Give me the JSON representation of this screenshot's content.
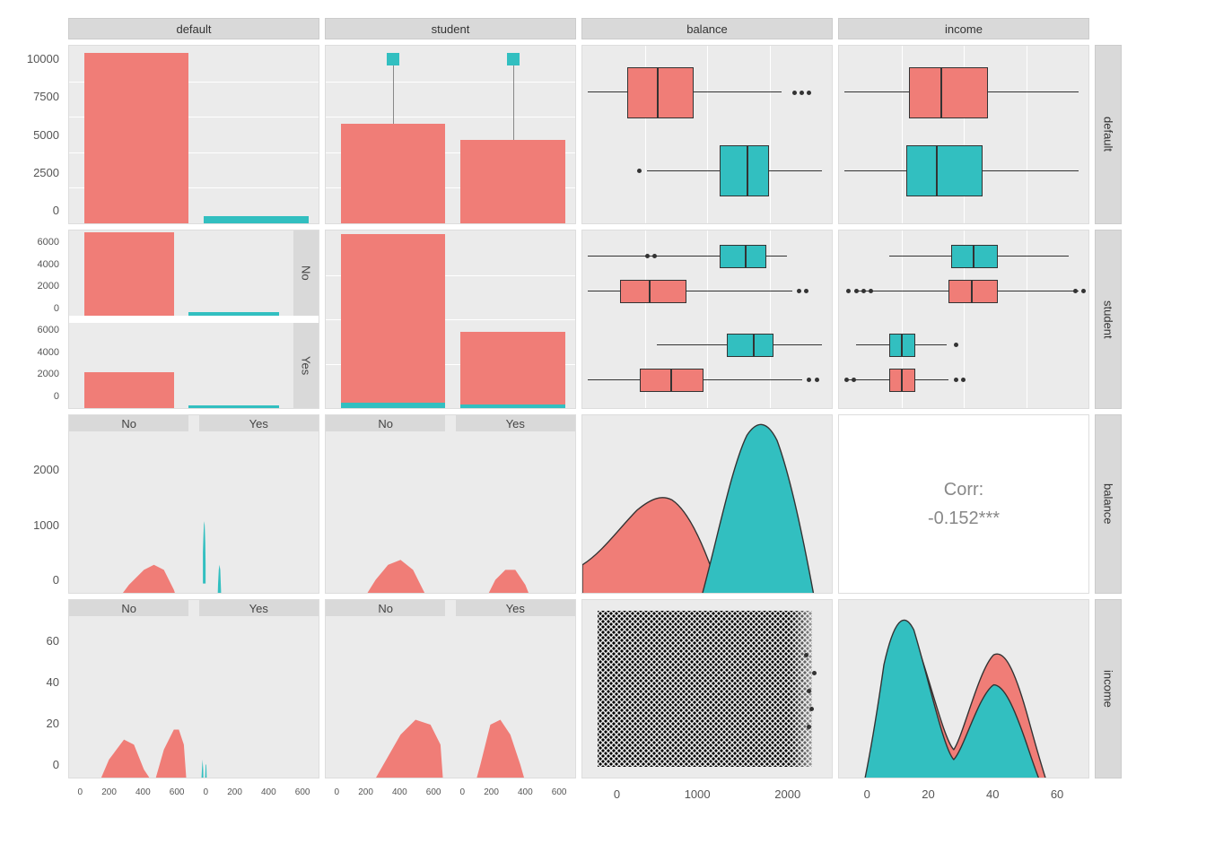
{
  "variables": [
    "default",
    "student",
    "balance",
    "income"
  ],
  "colors": {
    "No": "#f07d77",
    "Yes": "#32bfc0"
  },
  "correlation": {
    "label": "Corr:",
    "value": "-0.152***"
  },
  "facet_levels": {
    "default": [
      "No",
      "Yes"
    ],
    "student": [
      "No",
      "Yes"
    ]
  },
  "y_axes": {
    "row1": [
      "10000",
      "7500",
      "5000",
      "2500",
      "0"
    ],
    "row2": [
      "6000",
      "4000",
      "2000",
      "0",
      "6000",
      "4000",
      "2000",
      "0"
    ],
    "row3": [
      "2000",
      "1000",
      "0"
    ],
    "row4": [
      "60",
      "40",
      "20",
      "0"
    ]
  },
  "x_axes": {
    "col12_bottom": [
      "0",
      "200",
      "400",
      "600",
      "0",
      "200",
      "400",
      "600"
    ],
    "col3_bottom": [
      "0",
      "1000",
      "2000"
    ],
    "col4_bottom": [
      "0",
      "20",
      "40",
      "60"
    ]
  },
  "chart_data": [
    {
      "row": "default",
      "col": "default",
      "type": "bar",
      "x": [
        "No",
        "Yes"
      ],
      "y": [
        9667,
        333
      ],
      "fill": [
        "No",
        "Yes"
      ]
    },
    {
      "row": "default",
      "col": "student",
      "type": "bar",
      "x": [
        "No",
        "Yes"
      ],
      "y": [
        5600,
        4700
      ],
      "fill": "No",
      "overlay": [
        {
          "x": "No",
          "y": 9200,
          "shape": "square",
          "fill": "Yes"
        },
        {
          "x": "Yes",
          "y": 9200,
          "shape": "square",
          "fill": "Yes"
        }
      ]
    },
    {
      "row": "default",
      "col": "balance",
      "type": "boxplot",
      "groups": [
        {
          "group": "No",
          "q1": 480,
          "median": 820,
          "q3": 1170,
          "lw": 0,
          "uw": 2200,
          "outliers": [
            2400,
            2500,
            2600
          ]
        },
        {
          "group": "Yes",
          "q1": 1500,
          "median": 1790,
          "q3": 2000,
          "lw": 700,
          "uw": 2650,
          "outliers": [
            650
          ]
        }
      ],
      "xrange": [
        0,
        2700
      ]
    },
    {
      "row": "default",
      "col": "income",
      "type": "boxplot",
      "groups": [
        {
          "group": "No",
          "q1": 21,
          "median": 34,
          "q3": 44,
          "lw": 1,
          "uw": 73,
          "outliers": []
        },
        {
          "group": "Yes",
          "q1": 20,
          "median": 32,
          "q3": 43,
          "lw": 1,
          "uw": 73,
          "outliers": []
        }
      ],
      "xrange": [
        0,
        75
      ]
    },
    {
      "row": "student",
      "col": "default",
      "type": "bar",
      "facet": "student",
      "facets": {
        "No": [
          {
            "x": "No",
            "y": 6850,
            "fill": "No"
          },
          {
            "x": "Yes",
            "y": 200,
            "fill": "Yes"
          }
        ],
        "Yes": [
          {
            "x": "No",
            "y": 2817,
            "fill": "No"
          },
          {
            "x": "Yes",
            "y": 133,
            "fill": "Yes"
          }
        ]
      }
    },
    {
      "row": "student",
      "col": "student",
      "type": "bar",
      "x": [
        "No",
        "Yes"
      ],
      "y_No": [
        6850,
        2944
      ],
      "y_Yes_overlay": [
        206,
        127
      ]
    },
    {
      "row": "student",
      "col": "balance",
      "type": "boxplot",
      "facet": "student",
      "facets": {
        "No": [
          {
            "group": "No",
            "q1": 400,
            "median": 750,
            "q3": 1100,
            "lw": 0,
            "uw": 2100,
            "outliers": [
              2200,
              2300,
              2400
            ]
          },
          {
            "group": "Yes",
            "q1": 1480,
            "median": 1770,
            "q3": 1990,
            "lw": 700,
            "uw": 2600,
            "outliers": []
          }
        ],
        "Yes": [
          {
            "group": "No",
            "q1": 630,
            "median": 980,
            "q3": 1300,
            "lw": 0,
            "uw": 2300,
            "outliers": [
              2500,
              2600
            ]
          },
          {
            "group": "Yes",
            "q1": 1550,
            "median": 1820,
            "q3": 2050,
            "lw": 800,
            "uw": 2650,
            "outliers": []
          }
        ]
      },
      "xrange": [
        0,
        2700
      ]
    },
    {
      "row": "student",
      "col": "income",
      "type": "boxplot",
      "facet": "student",
      "facets": {
        "No": [
          {
            "group": "No",
            "q1": 33,
            "median": 40,
            "q3": 48,
            "lw": 15,
            "uw": 70,
            "outliers": [
              10,
              12,
              72,
              73
            ]
          },
          {
            "group": "Yes",
            "q1": 34,
            "median": 41,
            "q3": 48,
            "lw": 15,
            "uw": 68,
            "outliers": [
              9,
              11,
              71,
              73
            ]
          }
        ],
        "Yes": [
          {
            "group": "No",
            "q1": 15,
            "median": 18,
            "q3": 22,
            "lw": 5,
            "uw": 32,
            "outliers": [
              3,
              4,
              35,
              36
            ]
          },
          {
            "group": "Yes",
            "q1": 15,
            "median": 18,
            "q3": 22,
            "lw": 5,
            "uw": 31,
            "outliers": [
              4,
              34
            ]
          }
        ]
      },
      "xrange": [
        0,
        75
      ]
    },
    {
      "row": "balance",
      "col": "default",
      "type": "hist-facet",
      "facet": "default",
      "xmax": 700,
      "yrange": [
        0,
        2650
      ],
      "facets": {
        "No": {
          "fill": "No",
          "peak_y": 800,
          "peak_count": 700
        },
        "Yes": {
          "fill": "Yes",
          "peak_y": 1800,
          "peak_count": 60
        }
      }
    },
    {
      "row": "balance",
      "col": "student",
      "type": "hist-facet",
      "facet": "student",
      "xmax": 700,
      "yrange": [
        0,
        2650
      ],
      "facets": {
        "No": {
          "fill": "No",
          "peak_y": 750,
          "peak_count": 650
        },
        "Yes": {
          "fill": "No",
          "peak_y": 1000,
          "peak_count": 300,
          "secondary_fill": "Yes"
        }
      }
    },
    {
      "row": "balance",
      "col": "balance",
      "type": "density",
      "series": [
        {
          "fill": "No",
          "peak_x": 800
        },
        {
          "fill": "Yes",
          "peak_x": 1800
        }
      ],
      "xrange": [
        0,
        2700
      ]
    },
    {
      "row": "balance",
      "col": "income",
      "type": "correlation",
      "label": "Corr:",
      "value": "-0.152***"
    },
    {
      "row": "income",
      "col": "default",
      "type": "hist-facet",
      "facet": "default",
      "xmax": 700,
      "yrange": [
        0,
        75
      ],
      "facets": {
        "No": {
          "fill": "No",
          "bimodal": [
            18,
            40
          ]
        },
        "Yes": {
          "fill": "Yes",
          "bimodal": [
            18,
            40
          ]
        }
      }
    },
    {
      "row": "income",
      "col": "student",
      "type": "hist-facet",
      "facet": "student",
      "xmax": 700,
      "yrange": [
        0,
        75
      ],
      "facets": {
        "No": {
          "fill": "No",
          "peak_y": 40
        },
        "Yes": {
          "fill": "No",
          "peak_y": 18,
          "secondary_fill": "Yes"
        }
      }
    },
    {
      "row": "income",
      "col": "balance",
      "type": "scatter",
      "xrange": [
        0,
        2700
      ],
      "yrange": [
        0,
        75
      ],
      "n_approx": 10000
    },
    {
      "row": "income",
      "col": "income",
      "type": "density",
      "series": [
        {
          "fill": "No",
          "bimodal_x": [
            18,
            40
          ]
        },
        {
          "fill": "Yes",
          "peak_x": 18,
          "second_peak": 40
        }
      ],
      "xrange": [
        0,
        75
      ]
    }
  ]
}
